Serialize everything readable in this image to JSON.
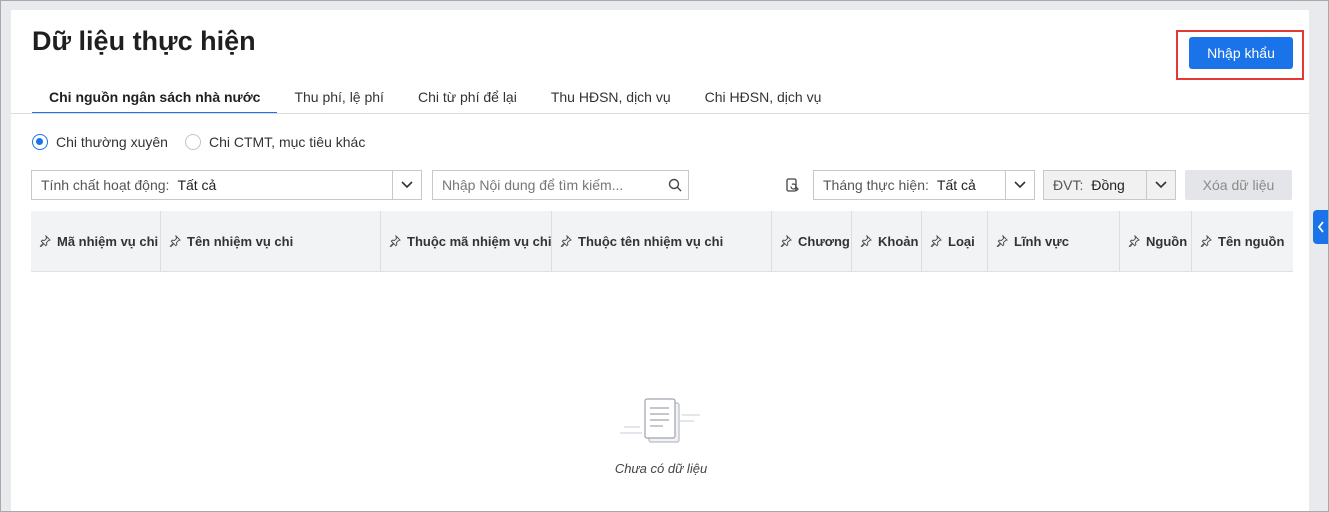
{
  "page": {
    "title": "Dữ liệu thực hiện",
    "import_label": "Nhập khẩu"
  },
  "tabs": [
    {
      "label": "Chi nguồn ngân sách nhà nước",
      "active": true
    },
    {
      "label": "Thu phí, lệ phí",
      "active": false
    },
    {
      "label": "Chi từ phí để lại",
      "active": false
    },
    {
      "label": "Thu HĐSN, dịch vụ",
      "active": false
    },
    {
      "label": "Chi HĐSN, dịch vụ",
      "active": false
    }
  ],
  "radios": [
    {
      "label": "Chi thường xuyên",
      "checked": true
    },
    {
      "label": "Chi CTMT, mục tiêu khác",
      "checked": false
    }
  ],
  "filters": {
    "nature": {
      "label": "Tính chất hoạt động:",
      "value": "Tất cả"
    },
    "search": {
      "placeholder": "Nhập Nội dung để tìm kiếm...",
      "value": ""
    },
    "month": {
      "label": "Tháng thực hiện:",
      "value": "Tất cả"
    },
    "unit": {
      "label": "ĐVT:",
      "value": "Đồng"
    },
    "clear_label": "Xóa dữ liệu"
  },
  "table": {
    "columns": [
      "Mã nhiệm vụ chi",
      "Tên nhiệm vụ chi",
      "Thuộc mã nhiệm vụ chi",
      "Thuộc tên nhiệm vụ chi",
      "Chương",
      "Khoản",
      "Loại",
      "Lĩnh vực",
      "Nguồn",
      "Tên nguồn"
    ],
    "empty_text": "Chưa có dữ liệu"
  },
  "icons": {
    "pin": "pin-icon",
    "chevron": "chevron-down-icon",
    "search": "search-icon",
    "refresh": "refresh-icon",
    "empty": "empty-document-icon",
    "side": "chevron-left-icon"
  },
  "colors": {
    "accent": "#1a73e8",
    "highlight": "#e53935"
  }
}
